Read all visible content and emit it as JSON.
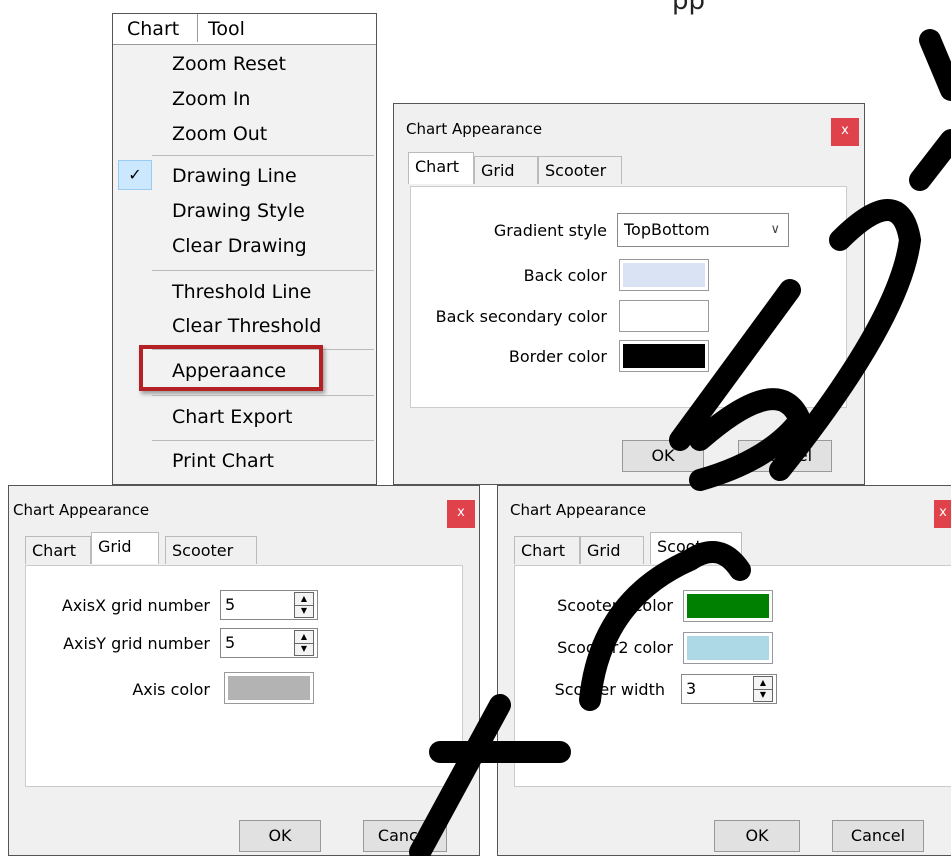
{
  "header_fragment": "pp",
  "menu": {
    "bar": {
      "chart": "Chart",
      "tool": "Tool"
    },
    "items": [
      "Zoom Reset",
      "Zoom In",
      "Zoom Out",
      "Drawing Line",
      "Drawing Style",
      "Clear Drawing",
      "Threshold Line",
      "Clear Threshold",
      "Apperaance",
      "Chart Export",
      "Print Chart"
    ],
    "checked_item": "Drawing Line",
    "highlighted_item": "Apperaance",
    "highlight_color": "#b52025"
  },
  "dialog_chart": {
    "title": "Chart Appearance",
    "close": "x",
    "tabs": [
      "Chart",
      "Grid",
      "Scooter"
    ],
    "active_tab": "Chart",
    "gradient_label": "Gradient style",
    "gradient_value": "TopBottom",
    "back_color_label": "Back color",
    "back_color": "#dae3f3",
    "back_secondary_label": "Back secondary color",
    "back_secondary_color": "#ffffff",
    "border_color_label": "Border color",
    "border_color": "#000000",
    "ok": "OK",
    "cancel": "Cancel"
  },
  "dialog_grid": {
    "title": "Chart Appearance",
    "close": "x",
    "tabs": [
      "Chart",
      "Grid",
      "Scooter"
    ],
    "active_tab": "Grid",
    "axisx_label": "AxisX grid number",
    "axisx_value": "5",
    "axisy_label": "AxisY grid number",
    "axisy_value": "5",
    "axis_color_label": "Axis color",
    "axis_color": "#b3b3b3",
    "ok": "OK",
    "cancel": "Cancel"
  },
  "dialog_scooter": {
    "title": "Chart Appearance",
    "close": "x",
    "tabs": [
      "Chart",
      "Grid",
      "Scooter"
    ],
    "active_tab": "Scooter",
    "scooter1_label": "Scooter1 color",
    "scooter1_color": "#008000",
    "scooter2_label": "Scooter2 color",
    "scooter2_color": "#add8e6",
    "width_label": "Scooter width",
    "width_value": "3",
    "ok": "OK",
    "cancel": "Cancel"
  }
}
